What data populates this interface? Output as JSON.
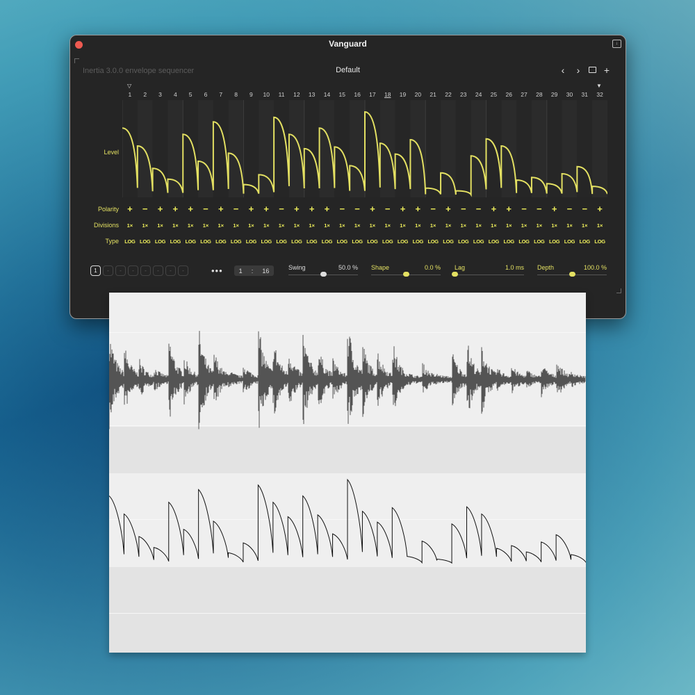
{
  "window": {
    "title": "Vanguard",
    "subtitle": "Inertia 3.0.0 envelope sequencer",
    "preset": "Default",
    "nav": {
      "prev": "‹",
      "next": "›",
      "add": "+"
    }
  },
  "steps": [
    "1",
    "2",
    "3",
    "4",
    "5",
    "6",
    "7",
    "8",
    "9",
    "10",
    "11",
    "12",
    "13",
    "14",
    "15",
    "16",
    "17",
    "18",
    "19",
    "20",
    "21",
    "22",
    "23",
    "24",
    "25",
    "26",
    "27",
    "28",
    "29",
    "30",
    "31",
    "32"
  ],
  "rows": {
    "level": "Level",
    "polarity": "Polarity",
    "divisions": "Divisions",
    "type": "Type"
  },
  "levels": [
    0.75,
    0.55,
    0.3,
    0.18,
    0.68,
    0.38,
    0.82,
    0.47,
    0.12,
    0.23,
    0.87,
    0.68,
    0.52,
    0.75,
    0.54,
    0.33,
    0.93,
    0.58,
    0.46,
    0.62,
    0.08,
    0.25,
    0.05,
    0.44,
    0.63,
    0.55,
    0.17,
    0.2,
    0.13,
    0.24,
    0.32,
    0.1
  ],
  "polarity": [
    "+",
    "−",
    "+",
    "+",
    "+",
    "−",
    "+",
    "−",
    "+",
    "+",
    "−",
    "+",
    "+",
    "+",
    "−",
    "−",
    "+",
    "−",
    "+",
    "+",
    "−",
    "+",
    "−",
    "−",
    "+",
    "+",
    "−",
    "−",
    "+",
    "−",
    "−",
    "+"
  ],
  "divisions": [
    "1×",
    "1×",
    "1×",
    "1×",
    "1×",
    "1×",
    "1×",
    "1×",
    "1×",
    "1×",
    "1×",
    "1×",
    "1×",
    "1×",
    "1×",
    "1×",
    "1×",
    "1×",
    "1×",
    "1×",
    "1×",
    "1×",
    "1×",
    "1×",
    "1×",
    "1×",
    "1×",
    "1×",
    "1×",
    "1×",
    "1×",
    "1×"
  ],
  "types": [
    "LOG",
    "LOG",
    "LOG",
    "LOG",
    "LOG",
    "LOG",
    "LOG",
    "LOG",
    "LOG",
    "LOG",
    "LOG",
    "LOG",
    "LOG",
    "LOG",
    "LOG",
    "LOG",
    "LOG",
    "LOG",
    "LOG",
    "LOG",
    "LOG",
    "LOG",
    "LOG",
    "LOG",
    "LOG",
    "LOG",
    "LOG",
    "LOG",
    "LOG",
    "LOG",
    "LOG",
    "LOG"
  ],
  "pages": {
    "active": "1",
    "others": [
      "-",
      "-",
      "-",
      "-",
      "-",
      "-",
      "-"
    ]
  },
  "more_label": "•••",
  "ratio": {
    "left": "1",
    "sep": ":",
    "right": "16"
  },
  "sliders": [
    {
      "label": "Swing",
      "value": "50.0 %",
      "level": 0.5,
      "color": "#dddddd"
    },
    {
      "label": "Shape",
      "value": "0.0 %",
      "level": 0.5,
      "color": "#e3e062"
    },
    {
      "label": "Lag",
      "value": "1.0 ms",
      "level": 0.0,
      "color": "#e3e062"
    },
    {
      "label": "Depth",
      "value": "100.0 %",
      "level": 0.5,
      "color": "#e3e062"
    }
  ],
  "colors": {
    "accent": "#e3e062",
    "window_bg": "#252525",
    "audio_bg": "#efefef"
  }
}
